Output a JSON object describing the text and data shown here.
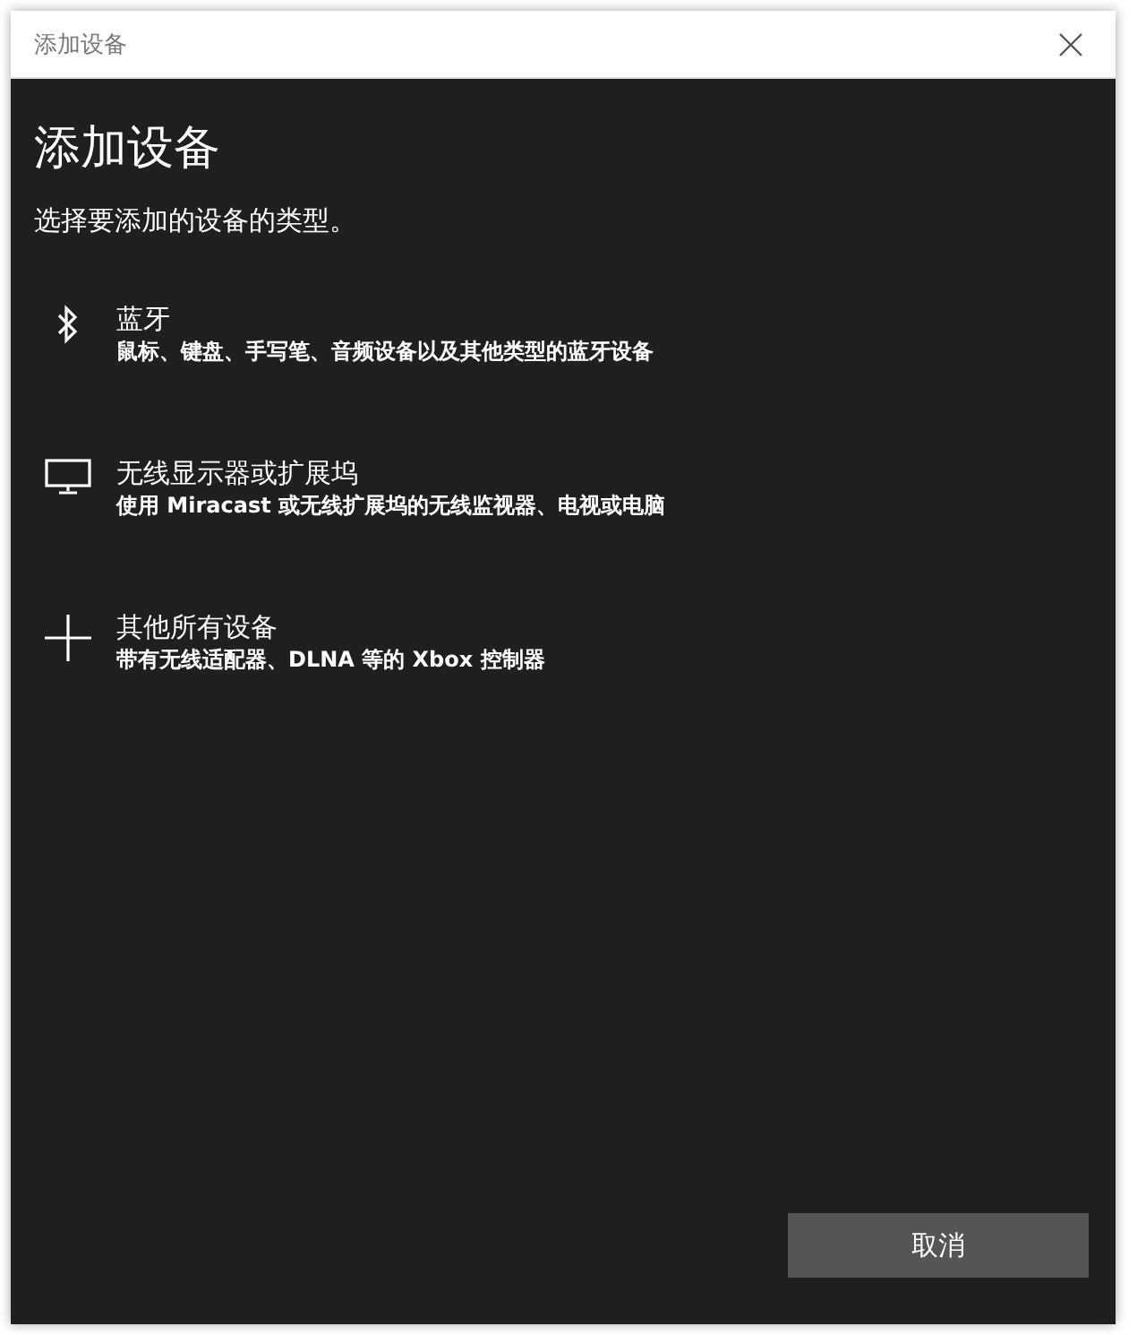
{
  "window": {
    "title": "添加设备"
  },
  "heading": "添加设备",
  "subtitle": "选择要添加的设备的类型。",
  "options": [
    {
      "kind": "bluetooth",
      "title": "蓝牙",
      "description": "鼠标、键盘、手写笔、音频设备以及其他类型的蓝牙设备"
    },
    {
      "kind": "display",
      "title": "无线显示器或扩展坞",
      "description": "使用 Miracast 或无线扩展坞的无线监视器、电视或电脑"
    },
    {
      "kind": "other",
      "title": "其他所有设备",
      "description": "带有无线适配器、DLNA 等的 Xbox 控制器"
    }
  ],
  "buttons": [
    "取消"
  ]
}
